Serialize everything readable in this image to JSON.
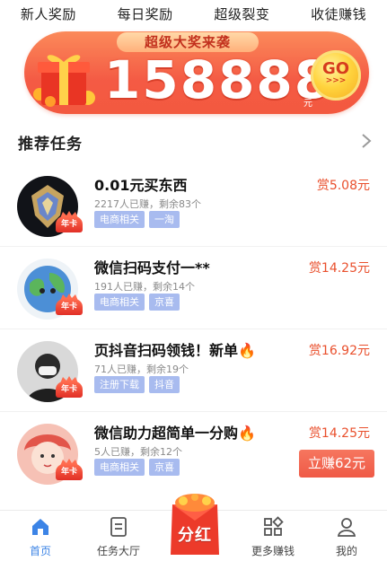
{
  "top_nav": [
    {
      "label": "新人奖励"
    },
    {
      "label": "每日奖励"
    },
    {
      "label": "超级裂变"
    },
    {
      "label": "收徒赚钱"
    }
  ],
  "banner": {
    "ribbon": "超级大奖来袭",
    "amount": "158888",
    "unit": "元",
    "go": "GO",
    "go_arrows": ">>>"
  },
  "section": {
    "title": "推荐任务"
  },
  "year_card_label": "年卡",
  "tasks": [
    {
      "title": "0.01元买东西",
      "meta": "2217人已赚，剩余83个",
      "tags": [
        "电商相关",
        "一淘"
      ],
      "reward": "赏5.08元"
    },
    {
      "title": "微信扫码支付一**",
      "meta": "191人已赚，剩余14个",
      "tags": [
        "电商相关",
        "京喜"
      ],
      "reward": "赏14.25元"
    },
    {
      "title": "页抖音扫码领钱！新单🔥",
      "meta": "71人已赚，剩余19个",
      "tags": [
        "注册下载",
        "抖音"
      ],
      "reward": "赏16.92元"
    },
    {
      "title": "微信助力超简单一分购🔥",
      "meta": "5人已赚，剩余12个",
      "tags": [
        "电商相关",
        "京喜"
      ],
      "reward": "赏14.25元",
      "button": "立赚62元"
    }
  ],
  "bottom_nav": {
    "home": "首页",
    "tasks_hall": "任务大厅",
    "dividend": "分红",
    "more": "更多赚钱",
    "mine": "我的"
  },
  "colors": {
    "accent_blue": "#3c84e6",
    "reward_red": "#e94f2c",
    "tag_blue": "#a8bbef",
    "banner_orange": "#f45a44"
  },
  "icons": [
    "gift-box-icon",
    "go-icon",
    "chevron-right-icon",
    "home-icon",
    "task-list-icon",
    "red-envelope-icon",
    "apps-grid-icon",
    "user-icon"
  ]
}
